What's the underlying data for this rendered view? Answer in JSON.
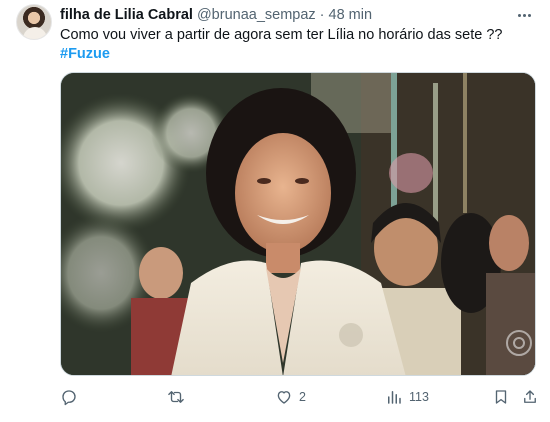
{
  "tweet": {
    "author": {
      "display_name": "filha de Lilia Cabral",
      "handle": "@brunaa_sempaz",
      "separator": "·",
      "time": "48 min"
    },
    "text": "Como vou viver a partir de agora sem ter Lília no horário das sete ??",
    "hashtag": "#Fuzue",
    "media": {
      "watermark_icon": "globo-logo-icon"
    },
    "actions": {
      "reply": {
        "icon": "reply-icon",
        "count": ""
      },
      "retweet": {
        "icon": "retweet-icon",
        "count": ""
      },
      "like": {
        "icon": "heart-icon",
        "count": "2"
      },
      "views": {
        "icon": "views-bar-chart-icon",
        "count": "113"
      },
      "bookmark": {
        "icon": "bookmark-icon"
      },
      "share": {
        "icon": "share-icon"
      }
    },
    "colors": {
      "link": "#1d9bf0",
      "muted": "#536471",
      "text": "#0f1419"
    }
  }
}
